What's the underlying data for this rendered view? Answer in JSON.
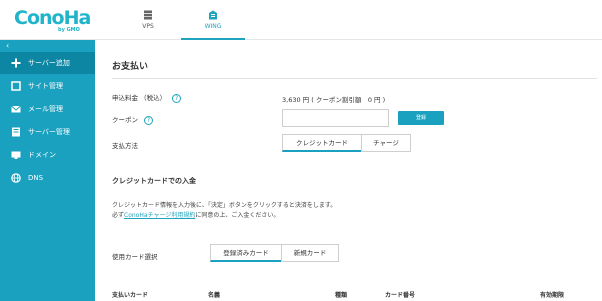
{
  "header": {
    "logo_text": "ConoHa",
    "logo_sub": "by GMO",
    "tabs": [
      {
        "label": "VPS"
      },
      {
        "label": "WING"
      }
    ]
  },
  "sidebar": {
    "collapse_glyph": "‹",
    "items": [
      {
        "label": "サーバー追加",
        "icon": "plus-icon"
      },
      {
        "label": "サイト管理",
        "icon": "site-icon"
      },
      {
        "label": "メール管理",
        "icon": "mail-icon"
      },
      {
        "label": "サーバー管理",
        "icon": "server-icon"
      },
      {
        "label": "ドメイン",
        "icon": "domain-icon"
      },
      {
        "label": "DNS",
        "icon": "globe-icon"
      }
    ]
  },
  "main": {
    "title": "お支払い",
    "fee_label": "申込料金 （税込）",
    "fee_value": "3,630 円 ( クーポン割引額　0 円 )",
    "coupon_label": "クーポン",
    "coupon_value": "",
    "apply_label": "登録",
    "method_label": "支払方法",
    "method_options": [
      "クレジットカード",
      "チャージ"
    ],
    "method_selected": "クレジットカード",
    "card_section_title": "クレジットカードでの入金",
    "desc_line1": "クレジットカード情報を入力後に、「決定」ボタンをクリックすると決済をします。",
    "desc_line2_prefix": "必ず",
    "desc_line2_link": "ConoHaチャージ利用規約",
    "desc_line2_suffix": "に同意の上、ご入金ください。",
    "card_select_label": "使用カード選択",
    "card_options": [
      "登録済みカード",
      "新規カード"
    ],
    "card_selected": "登録済みカード",
    "table_headers": [
      "支払いカード",
      "名義",
      "種類",
      "カード番号",
      "有効期限"
    ],
    "help_glyph": "?"
  },
  "colors": {
    "brand": "#1fb4c9",
    "sidebar": "#1aa1c0",
    "sidebar_active": "#0d86a4"
  }
}
